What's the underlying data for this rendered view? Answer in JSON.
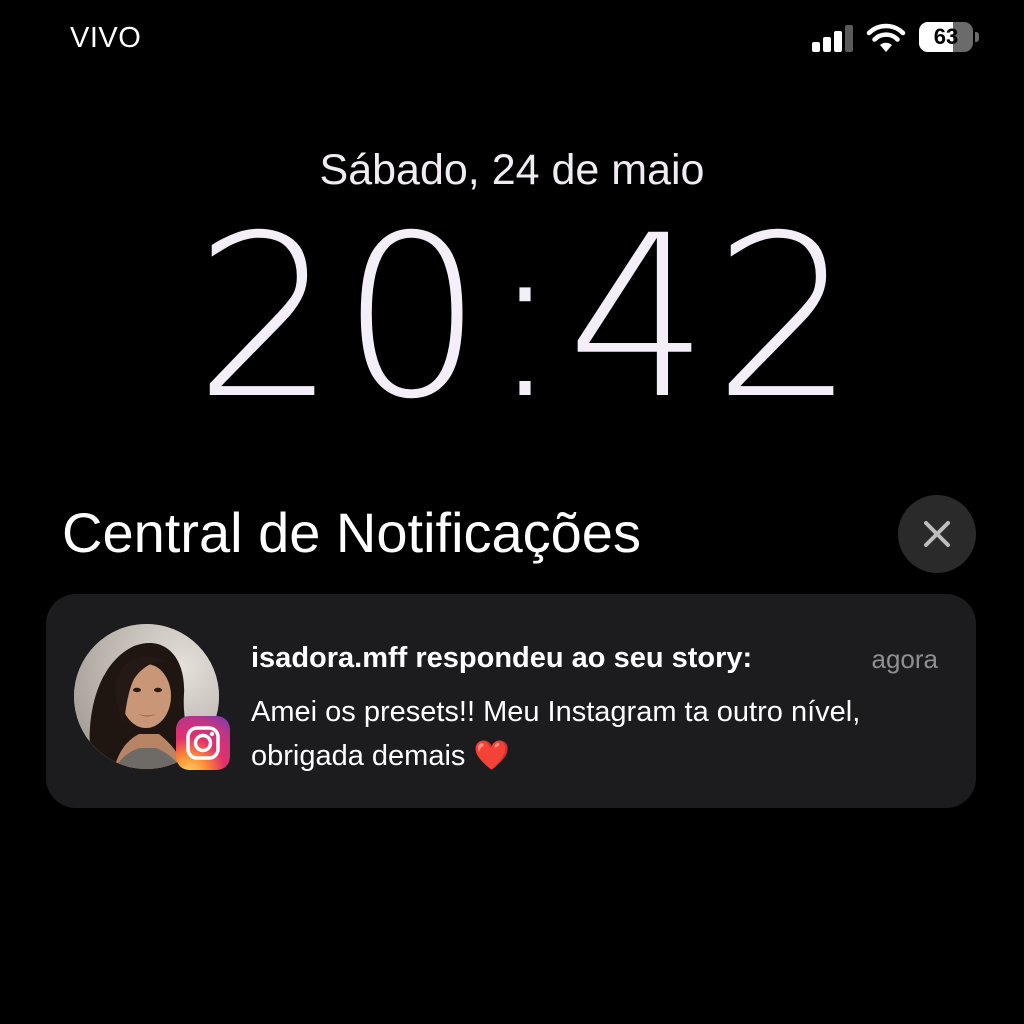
{
  "status_bar": {
    "carrier": "VIVO",
    "signal_bars_active": 3,
    "signal_bars_total": 4,
    "battery_percent": "63",
    "battery_level": 0.63
  },
  "lock_screen": {
    "date": "Sábado, 24 de maio",
    "time": "20:42"
  },
  "notification_center": {
    "title": "Central de Notificações",
    "close_icon": "close-icon"
  },
  "notifications": [
    {
      "app": "Instagram",
      "app_icon": "instagram-icon",
      "avatar": "avatar-photo",
      "title": "isadora.mff respondeu ao seu story:",
      "time": "agora",
      "body": "Amei os presets!! Meu Instagram ta outro nível, obrigada demais",
      "emoji": "❤️"
    }
  ],
  "colors": {
    "background": "#000000",
    "card": "#1c1c1e",
    "close_button": "#2a2a2a",
    "secondary_text": "#8e8e93",
    "clock": "#f3eef8"
  }
}
